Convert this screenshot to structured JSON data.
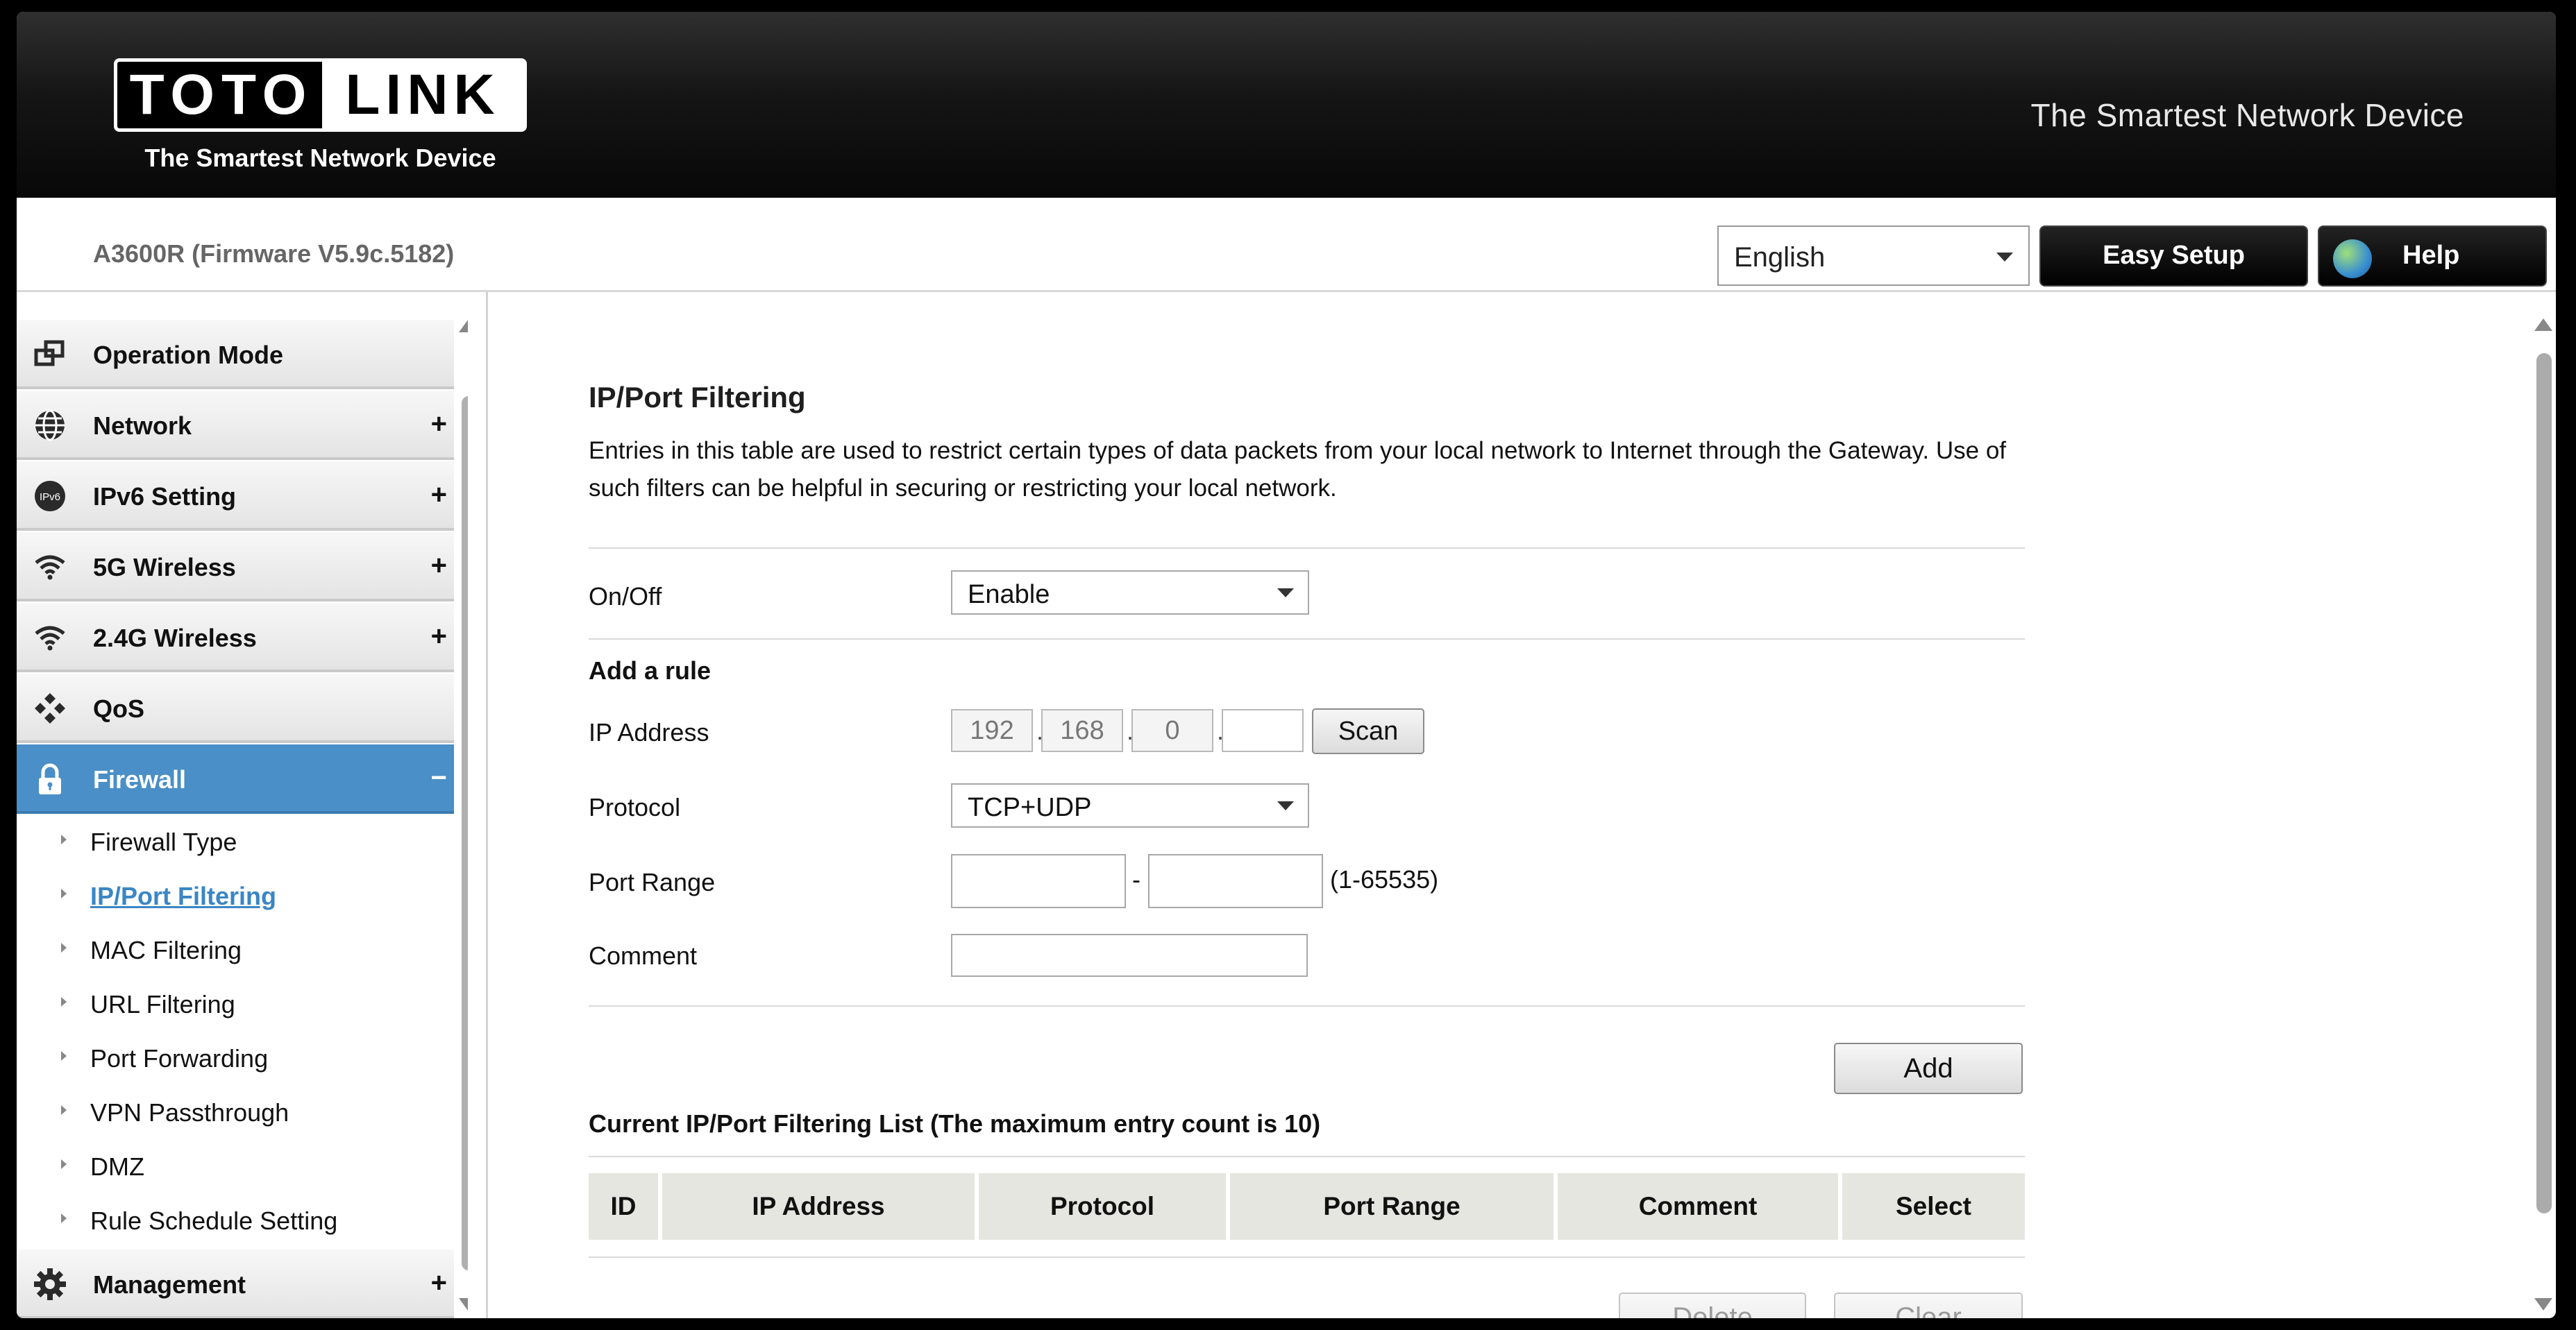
{
  "header": {
    "logo_left": "TOTO",
    "logo_right": "LINK",
    "logo_tagline": "The Smartest Network Device",
    "slogan": "The Smartest Network Device"
  },
  "subbar": {
    "model": "A3600R (Firmware V5.9c.5182)",
    "language": "English",
    "easy_setup": "Easy Setup",
    "help": "Help"
  },
  "sidebar": {
    "items": [
      {
        "label": "Operation Mode",
        "icon": "operation-mode-icon",
        "expand": ""
      },
      {
        "label": "Network",
        "icon": "globe-icon",
        "expand": "+"
      },
      {
        "label": "IPv6 Setting",
        "icon": "ipv6-icon",
        "expand": "+"
      },
      {
        "label": "5G Wireless",
        "icon": "wifi-icon",
        "expand": "+"
      },
      {
        "label": "2.4G Wireless",
        "icon": "wifi-icon",
        "expand": "+"
      },
      {
        "label": "QoS",
        "icon": "qos-icon",
        "expand": ""
      },
      {
        "label": "Firewall",
        "icon": "lock-icon",
        "expand": "−"
      },
      {
        "label": "Management",
        "icon": "gear-icon",
        "expand": "+"
      }
    ],
    "firewall_sub": [
      "Firewall Type",
      "IP/Port Filtering",
      "MAC Filtering",
      "URL Filtering",
      "Port Forwarding",
      "VPN Passthrough",
      "DMZ",
      "Rule Schedule Setting"
    ],
    "active_item": "Firewall",
    "current_sub": "IP/Port Filtering"
  },
  "main": {
    "title": "IP/Port Filtering",
    "description": "Entries in this table are used to restrict certain types of data packets from your local network to Internet through the Gateway. Use of such filters can be helpful in securing or restricting your local network.",
    "onoff_label": "On/Off",
    "onoff_value": "Enable",
    "add_rule_title": "Add a rule",
    "ip_label": "IP Address",
    "ip_octets": [
      "192",
      "168",
      "0",
      ""
    ],
    "ip_dot": ".",
    "scan_label": "Scan",
    "protocol_label": "Protocol",
    "protocol_value": "TCP+UDP",
    "port_range_label": "Port Range",
    "port_from": "",
    "port_to": "",
    "port_dash": "-",
    "port_hint": "(1-65535)",
    "comment_label": "Comment",
    "comment_value": "",
    "add_label": "Add",
    "list_title": "Current IP/Port Filtering List (The maximum entry count is 10)",
    "table_headers": [
      "ID",
      "IP Address",
      "Protocol",
      "Port Range",
      "Comment",
      "Select"
    ],
    "delete_label": "Delete",
    "clear_label": "Clear"
  },
  "colors": {
    "accent": "#4a8fc7",
    "link": "#3b86c4",
    "header_bg": "#111111",
    "table_header_bg": "#e6e6e0"
  }
}
